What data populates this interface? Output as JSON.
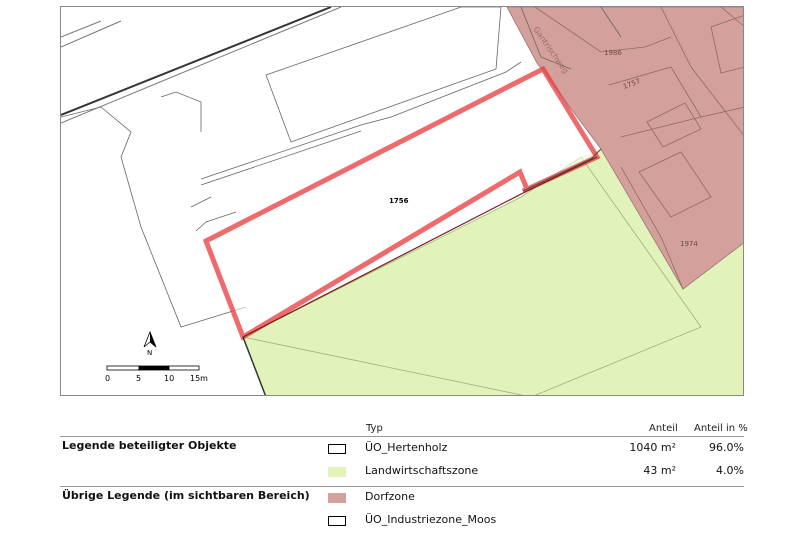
{
  "map": {
    "parcels": [
      {
        "number": "1756"
      },
      {
        "number": "1986"
      },
      {
        "number": "1757"
      },
      {
        "number": "1974"
      }
    ],
    "street": "Gantrischweg",
    "north_label": "N",
    "scalebar": {
      "ticks": [
        "0",
        "5",
        "10",
        "15m"
      ]
    },
    "colors": {
      "selection": "#e8383b",
      "landwirtschaft": "#e1f3bb",
      "dorfzone": "#d4a09b",
      "line": "#555555"
    }
  },
  "legend": {
    "columns": {
      "typ": "Typ",
      "anteil": "Anteil",
      "anteil_pct": "Anteil in %"
    },
    "sections": [
      {
        "title": "Legende beteiligter Objekte",
        "items": [
          {
            "label": "ÜO_Hertenholz",
            "swatch": "#ffffff",
            "border": "#000000",
            "anteil": "1040 m²",
            "pct": "96.0%"
          },
          {
            "label": "Landwirtschaftszone",
            "swatch": "#e1f3bb",
            "border": "#e1f3bb",
            "anteil": "43 m²",
            "pct": "4.0%"
          }
        ]
      },
      {
        "title": "Übrige Legende (im sichtbaren Bereich)",
        "items": [
          {
            "label": "Dorfzone",
            "swatch": "#d4a09b",
            "border": "#d4a09b"
          },
          {
            "label": "ÜO_Industriezone_Moos",
            "swatch": "#ffffff",
            "border": "#000000"
          }
        ]
      }
    ]
  }
}
